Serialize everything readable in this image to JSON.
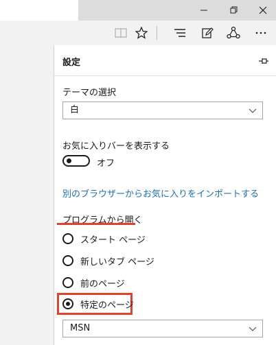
{
  "panel": {
    "title": "設定",
    "theme_label": "テーマの選択",
    "theme_value": "白",
    "favbar_label": "お気に入りバーを表示する",
    "favbar_toggle_text": "オフ",
    "import_link": "別のブラウザーからお気に入りをインポートする",
    "open_with_label": "プログラムから開く",
    "open_with_options": [
      {
        "label": "スタート ページ",
        "checked": false
      },
      {
        "label": "新しいタブ ページ",
        "checked": false
      },
      {
        "label": "前のページ",
        "checked": false
      },
      {
        "label": "特定のページ",
        "checked": true
      }
    ],
    "specific_page_value": "MSN"
  },
  "colors": {
    "accent_link": "#1a6fb5",
    "annotation_red": "#e2412b"
  },
  "icons": [
    "minimize-icon",
    "restore-icon",
    "close-icon",
    "reading-view-icon",
    "favorite-star-icon",
    "hub-icon",
    "web-note-icon",
    "share-icon",
    "more-icon",
    "pin-icon",
    "chevron-down-icon"
  ]
}
